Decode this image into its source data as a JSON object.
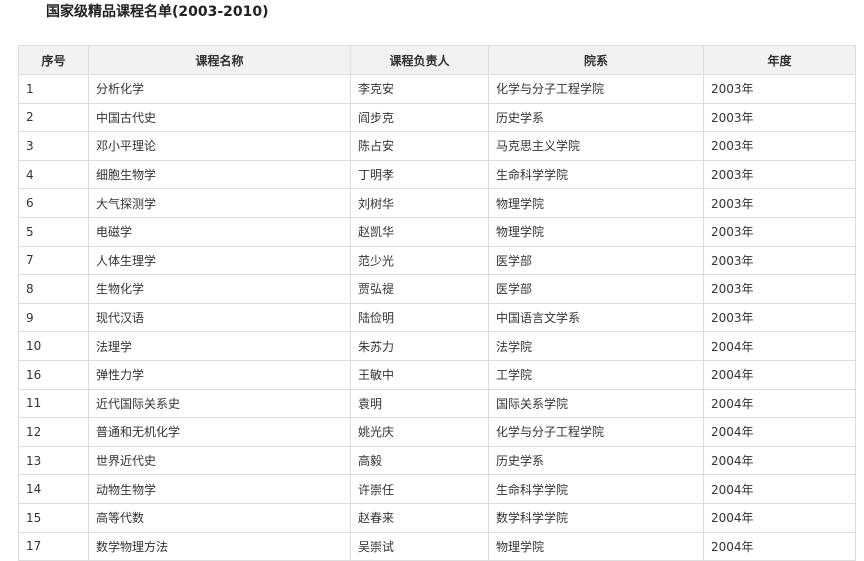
{
  "title": "国家级精品课程名单(2003-2010)",
  "table": {
    "headers": [
      "序号",
      "课程名称",
      "课程负责人",
      "院系",
      "年度"
    ],
    "rows": [
      [
        "1",
        "分析化学",
        "李克安",
        "化学与分子工程学院",
        "2003年"
      ],
      [
        "2",
        "中国古代史",
        "阎步克",
        "历史学系",
        "2003年"
      ],
      [
        "3",
        "邓小平理论",
        "陈占安",
        "马克思主义学院",
        "2003年"
      ],
      [
        "4",
        "细胞生物学",
        "丁明孝",
        "生命科学学院",
        "2003年"
      ],
      [
        "6",
        "大气探测学",
        "刘树华",
        "物理学院",
        "2003年"
      ],
      [
        "5",
        "电磁学",
        "赵凯华",
        "物理学院",
        "2003年"
      ],
      [
        "7",
        "人体生理学",
        "范少光",
        "医学部",
        "2003年"
      ],
      [
        "8",
        "生物化学",
        "贾弘禔",
        "医学部",
        "2003年"
      ],
      [
        "9",
        "现代汉语",
        "陆俭明",
        "中国语言文学系",
        "2003年"
      ],
      [
        "10",
        "法理学",
        "朱苏力",
        "法学院",
        "2004年"
      ],
      [
        "16",
        "弹性力学",
        "王敏中",
        "工学院",
        "2004年"
      ],
      [
        "11",
        "近代国际关系史",
        "袁明",
        "国际关系学院",
        "2004年"
      ],
      [
        "12",
        "普通和无机化学",
        "姚光庆",
        "化学与分子工程学院",
        "2004年"
      ],
      [
        "13",
        "世界近代史",
        "高毅",
        "历史学系",
        "2004年"
      ],
      [
        "14",
        "动物生物学",
        "许崇任",
        "生命科学学院",
        "2004年"
      ],
      [
        "15",
        "高等代数",
        "赵春来",
        "数学科学学院",
        "2004年"
      ],
      [
        "17",
        "数学物理方法",
        "吴崇试",
        "物理学院",
        "2004年"
      ]
    ]
  }
}
